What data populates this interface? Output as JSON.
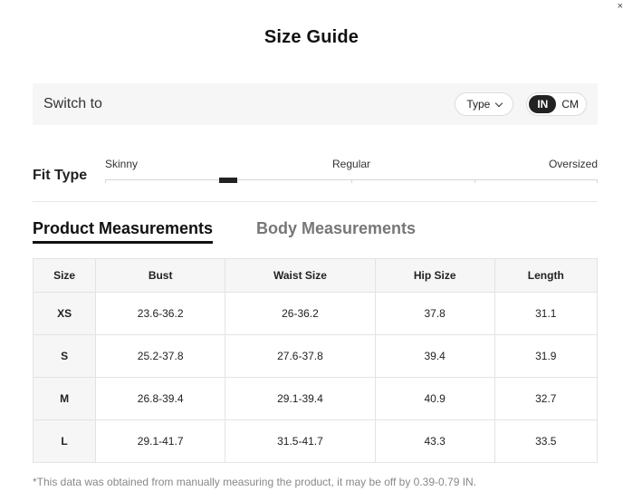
{
  "dialog": {
    "close_glyph": "×"
  },
  "title": "Size Guide",
  "switch_bar": {
    "label": "Switch to",
    "type_button": "Type",
    "units": [
      {
        "label": "IN",
        "active": true
      },
      {
        "label": "CM",
        "active": false
      }
    ]
  },
  "fit_type": {
    "title": "Fit Type",
    "labels": [
      "Skinny",
      "Regular",
      "Oversized"
    ],
    "selected_position": 0.25
  },
  "tabs": [
    {
      "label": "Product Measurements",
      "active": true
    },
    {
      "label": "Body Measurements",
      "active": false
    }
  ],
  "table": {
    "headers": [
      "Size",
      "Bust",
      "Waist Size",
      "Hip Size",
      "Length"
    ],
    "rows": [
      [
        "XS",
        "23.6-36.2",
        "26-36.2",
        "37.8",
        "31.1"
      ],
      [
        "S",
        "25.2-37.8",
        "27.6-37.8",
        "39.4",
        "31.9"
      ],
      [
        "M",
        "26.8-39.4",
        "29.1-39.4",
        "40.9",
        "32.7"
      ],
      [
        "L",
        "29.1-41.7",
        "31.5-41.7",
        "43.3",
        "33.5"
      ]
    ]
  },
  "footnote": "*This data was obtained from manually measuring the product, it may be off by 0.39-0.79 IN.",
  "colors": {
    "accent": "#222222",
    "panel": "#f6f6f6",
    "muted_text": "#888888"
  }
}
